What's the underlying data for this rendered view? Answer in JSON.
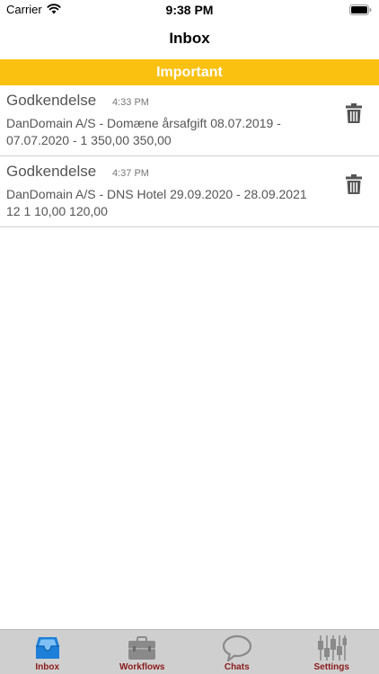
{
  "status_bar": {
    "carrier": "Carrier",
    "time": "9:38 PM"
  },
  "nav": {
    "title": "Inbox"
  },
  "section": {
    "label": "Important"
  },
  "items": [
    {
      "title": "Godkendelse",
      "time": "4:33 PM",
      "description": "DanDomain A/S - Domæne årsafgift 08.07.2019 - 07.07.2020 - 1 350,00 350,00"
    },
    {
      "title": "Godkendelse",
      "time": "4:37 PM",
      "description": "DanDomain A/S - DNS Hotel 29.09.2020 - 28.09.2021 12 1 10,00 120,00"
    }
  ],
  "tabs": [
    {
      "label": "Inbox",
      "icon": "inbox-tray-icon",
      "selected": true
    },
    {
      "label": "Workflows",
      "icon": "briefcase-icon",
      "selected": false
    },
    {
      "label": "Chats",
      "icon": "speech-bubble-icon",
      "selected": false
    },
    {
      "label": "Settings",
      "icon": "sliders-icon",
      "selected": false
    }
  ],
  "colors": {
    "accent": "#fbc111",
    "tab_label": "#8b1a1a",
    "selected_icon": "#1e7fd9",
    "tab_bar": "#cfcfcf"
  }
}
